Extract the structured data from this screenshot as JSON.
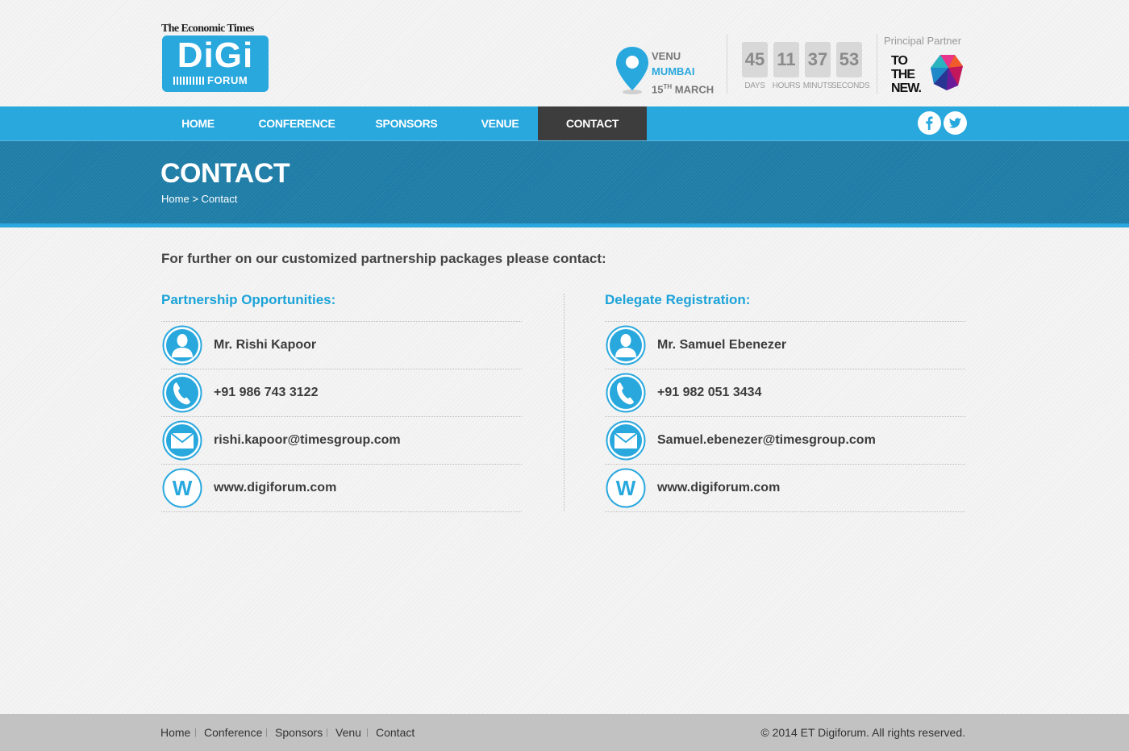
{
  "logo": {
    "top_text": "The Economic Times",
    "digi": "DiGi",
    "forum": "FORUM"
  },
  "venue": {
    "label": "VENU",
    "city": "MUMBAI",
    "day": "15",
    "day_suffix": "TH",
    "month": "MARCH"
  },
  "countdown": [
    {
      "value": "45",
      "label": "DAYS"
    },
    {
      "value": "11",
      "label": "HOURS"
    },
    {
      "value": "37",
      "label": "MINUTS"
    },
    {
      "value": "53",
      "label": "SECONDS"
    }
  ],
  "partner": {
    "label": "Principal Partner",
    "name_line1": "TO",
    "name_line2": "THE",
    "name_line3": "NEW."
  },
  "nav": {
    "items": [
      {
        "label": "HOME"
      },
      {
        "label": "CONFERENCE"
      },
      {
        "label": "SPONSORS"
      },
      {
        "label": "VENUE"
      },
      {
        "label": "CONTACT",
        "active": true
      }
    ],
    "social": {
      "facebook": "f",
      "twitter": "t"
    }
  },
  "banner": {
    "title": "CONTACT",
    "breadcrumb_home": "Home",
    "breadcrumb_sep": ">",
    "breadcrumb_current": "Contact"
  },
  "intro": "For further on our customized partnership packages please contact:",
  "partnership": {
    "title": "Partnership Opportunities:",
    "name": "Mr. Rishi Kapoor",
    "phone": "+91 986 743 3122",
    "email": "rishi.kapoor@timesgroup.com",
    "website": "www.digiforum.com"
  },
  "delegate": {
    "title": "Delegate Registration:",
    "name": "Mr. Samuel Ebenezer",
    "phone": "+91 982 051 3434",
    "email": "Samuel.ebenezer@timesgroup.com",
    "website": "www.digiforum.com"
  },
  "footer": {
    "links": [
      "Home",
      "Conference",
      "Sponsors",
      "Venu",
      "Contact"
    ],
    "separator": "|",
    "copyright": "© 2014 ET Digiforum. All rights reserved."
  },
  "colors": {
    "accent": "#29a8de",
    "nav_active": "#3d3d3d",
    "banner": "#1d7ca6",
    "footer": "#c2c2c2"
  },
  "icons": [
    "map-pin-icon",
    "user-icon",
    "phone-icon",
    "mail-icon",
    "web-icon",
    "facebook-icon",
    "twitter-icon"
  ]
}
